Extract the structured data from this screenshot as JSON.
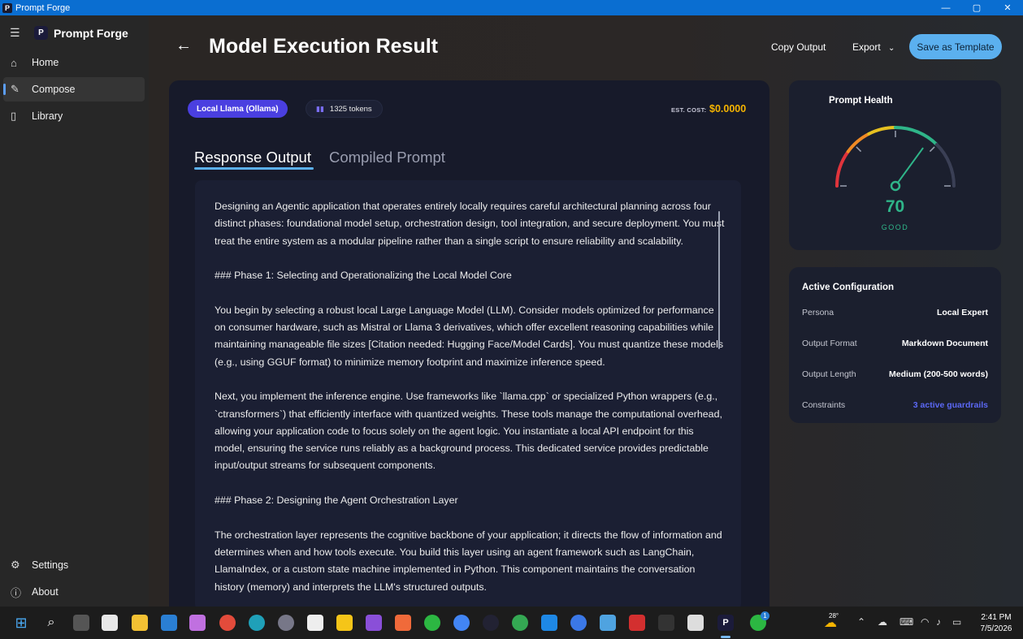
{
  "window": {
    "title": "Prompt Forge",
    "app_icon_letter": "P",
    "controls": {
      "minimize": "—",
      "maximize": "▢",
      "close": "✕"
    }
  },
  "sidebar": {
    "brand": "Prompt Forge",
    "brand_letter": "P",
    "menu_icon": "menu-icon",
    "items": [
      {
        "label": "Home",
        "icon": "home-icon",
        "glyph": "⌂"
      },
      {
        "label": "Compose",
        "icon": "pencil-icon",
        "glyph": "✎",
        "active": true
      },
      {
        "label": "Library",
        "icon": "document-icon",
        "glyph": "▯"
      }
    ],
    "bottom_items": [
      {
        "label": "Settings",
        "icon": "gear-icon",
        "glyph": "⚙"
      },
      {
        "label": "About",
        "icon": "info-icon",
        "glyph": "ⓘ"
      }
    ]
  },
  "header": {
    "title": "Model Execution Result",
    "copy_output": "Copy Output",
    "export": "Export",
    "export_chevron": "⌄",
    "save_template": "Save as Template"
  },
  "result": {
    "model": "Local Llama (Ollama)",
    "tokens": "1325 tokens",
    "cost_label": "EST. COST:",
    "cost_value": "$0.0000",
    "tabs": {
      "response": "Response Output",
      "compiled": "Compiled Prompt",
      "active": "response"
    },
    "paragraphs": [
      "Designing an Agentic application that operates entirely locally requires careful architectural planning across four distinct phases: foundational model setup, orchestration design, tool integration, and secure deployment. You must treat the entire system as a modular pipeline rather than a single script to ensure reliability and scalability.",
      "### Phase 1: Selecting and Operationalizing the Local Model Core",
      "You begin by selecting a robust local Large Language Model (LLM). Consider models optimized for performance on consumer hardware, such as Mistral or Llama 3 derivatives, which offer excellent reasoning capabilities while maintaining manageable file sizes [Citation needed: Hugging Face/Model Cards]. You must quantize these models (e.g., using GGUF format) to minimize memory footprint and maximize inference speed.",
      "Next, you implement the inference engine. Use frameworks like `llama.cpp` or specialized Python wrappers (e.g., `ctransformers`) that efficiently interface with quantized weights. These tools manage the computational overhead, allowing your application code to focus solely on the agent logic. You instantiate a local API endpoint for this model, ensuring the service runs reliably as a background process. This dedicated service provides predictable input/output streams for subsequent components.",
      "### Phase 2: Designing the Agent Orchestration Layer",
      "The orchestration layer represents the cognitive backbone of your application; it directs the flow of information and determines when and how tools execute. You build this layer using an agent framework such as LangChain, LlamaIndex, or a custom state machine implemented in Python. This component maintains the conversation history (memory) and interprets the LLM's structured outputs."
    ]
  },
  "health": {
    "title": "Prompt Health",
    "score": 70,
    "score_text": "70",
    "label": "GOOD",
    "max": 100,
    "colors": {
      "red": "#e0343c",
      "orange": "#f08a24",
      "yellow": "#e6c020",
      "green": "#2fb589",
      "track": "#3a3f55"
    }
  },
  "config": {
    "title": "Active Configuration",
    "rows": [
      {
        "key": "Persona",
        "value": "Local Expert"
      },
      {
        "key": "Output Format",
        "value": "Markdown Document"
      },
      {
        "key": "Output Length",
        "value": "Medium (200-500 words)"
      },
      {
        "key": "Constraints",
        "value": "3 active guardrails",
        "accent": true
      }
    ]
  },
  "taskbar": {
    "weather": "28°",
    "time": "2:41 PM",
    "date": "7/5/2026",
    "notification_count": "1",
    "apps": [
      "start-icon",
      "search-icon",
      "task-view-icon",
      "store-icon",
      "file-explorer-icon",
      "mail-icon",
      "copilot-icon",
      "chrome-icon",
      "edge-icon",
      "settings-icon",
      "app-icon",
      "sticky-notes-icon",
      "visual-studio-icon",
      "spark-icon",
      "whatsapp-icon",
      "chrome-icon",
      "obs-icon",
      "chrome-icon",
      "vscode-icon",
      "sync-icon",
      "notepad-icon",
      "acrobat-icon",
      "terminal-icon",
      "linux-icon",
      "prompt-forge-icon",
      "whatsapp-icon"
    ]
  }
}
